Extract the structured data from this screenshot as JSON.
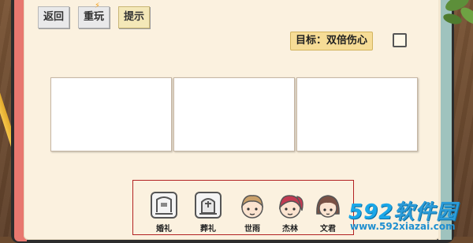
{
  "toolbar": {
    "back_label": "返回",
    "replay_label": "重玩",
    "hint_label": "提示"
  },
  "goal": {
    "text": "目标：双倍伤心",
    "completed": false
  },
  "frames": [
    "",
    "",
    ""
  ],
  "inventory": {
    "items": [
      {
        "label": "婚礼",
        "icon": "wedding-card-icon"
      },
      {
        "label": "葬礼",
        "icon": "funeral-tombstone-icon"
      },
      {
        "label": "世雨",
        "icon": "boy-character-icon"
      },
      {
        "label": "杰林",
        "icon": "girl-ponytail-character-icon"
      },
      {
        "label": "文君",
        "icon": "girl-short-hair-character-icon"
      }
    ]
  },
  "watermark": {
    "logo_number": "592",
    "logo_text": "软件园",
    "url": "www.592xiazai.com"
  },
  "colors": {
    "page": "#fbf1df",
    "goal_bg": "#f6dc96",
    "tray_border": "#b22222",
    "watermark": "#1aa7e8"
  }
}
